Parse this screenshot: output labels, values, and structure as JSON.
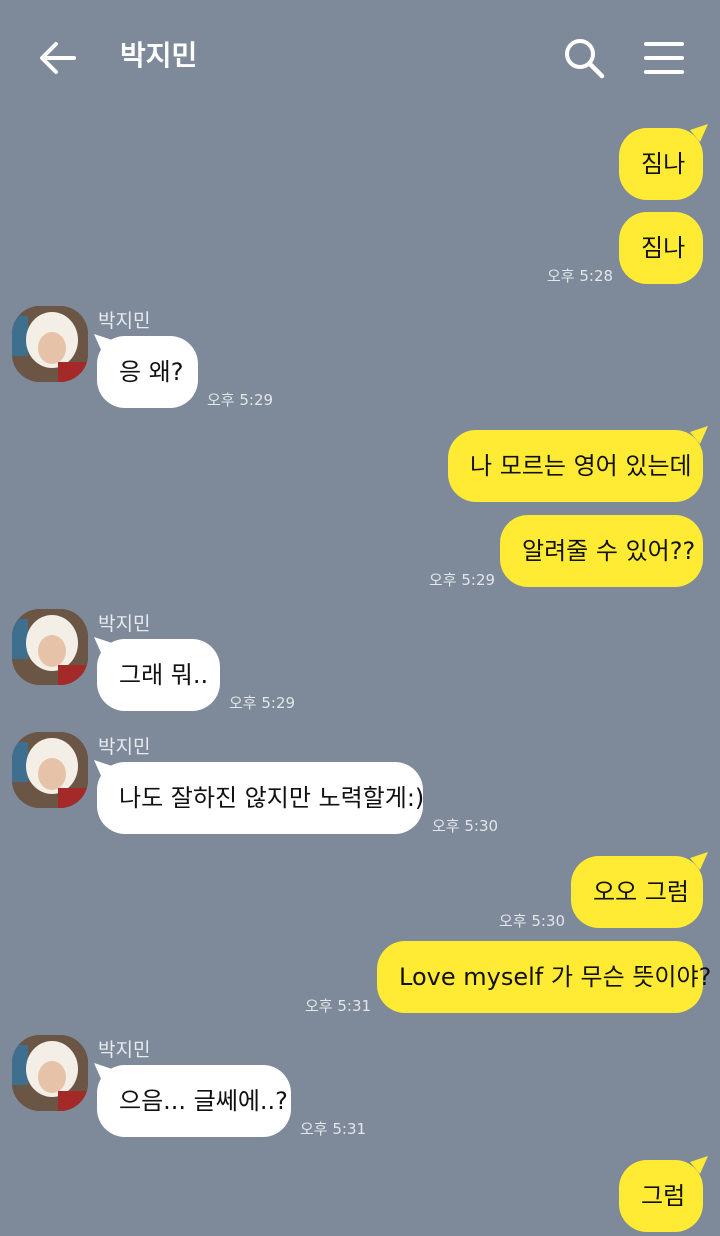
{
  "header": {
    "title": "박지민",
    "back_icon": "arrow-left-icon",
    "search_icon": "search-icon",
    "menu_icon": "hamburger-menu-icon"
  },
  "colors": {
    "background": "#7e8a9a",
    "my_bubble": "#ffeb33",
    "their_bubble": "#ffffff"
  },
  "messages": [
    {
      "from": "me",
      "text": "짐나"
    },
    {
      "from": "me",
      "text": "짐나",
      "time": "오후 5:28"
    },
    {
      "from": "them",
      "sender": "박지민",
      "text": "응 왜?",
      "time": "오후 5:29"
    },
    {
      "from": "me",
      "text": "나 모르는 영어 있는데"
    },
    {
      "from": "me",
      "text": "알려줄 수 있어??",
      "time": "오후 5:29"
    },
    {
      "from": "them",
      "sender": "박지민",
      "text": "그래 뭐..",
      "time": "오후 5:29"
    },
    {
      "from": "them",
      "sender": "박지민",
      "text": "나도 잘하진 않지만 노력할게:)",
      "time": "오후 5:30"
    },
    {
      "from": "me",
      "text": "오오 그럼",
      "time": "오후 5:30"
    },
    {
      "from": "me",
      "text": "Love myself 가 무슨 뜻이야?",
      "time": "오후 5:31"
    },
    {
      "from": "them",
      "sender": "박지민",
      "text": "으음... 글쎄에..?",
      "time": "오후 5:31"
    },
    {
      "from": "me",
      "text": "그럼"
    }
  ]
}
